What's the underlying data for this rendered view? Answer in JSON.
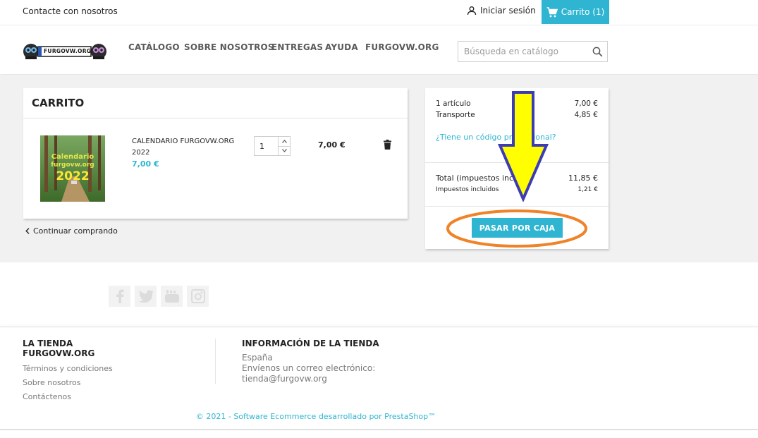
{
  "topbar": {
    "contact": "Contacte con nosotros",
    "signin": "Iniciar sesión",
    "cart": "Carrito (1)"
  },
  "header": {
    "logo_text": "FURGOVW.ORG",
    "menu": [
      "CATÁLOGO",
      "SOBRE NOSOTROS",
      "ENTREGAS",
      "AYUDA",
      "FURGOVW.ORG"
    ],
    "search_placeholder": "Búsqueda en catálogo"
  },
  "cart": {
    "title": "CARRITO",
    "product": {
      "name": "CALENDARIO FURGOVW.ORG 2022",
      "price": "7,00 €",
      "image_text_line1": "Calendario",
      "image_text_line2": "furgovw.org",
      "image_text_line3": "2022",
      "quantity": "1",
      "line_total": "7,00 €"
    },
    "continue": "Continuar comprando"
  },
  "summary": {
    "items_label": "1 artículo",
    "items_value": "7,00 €",
    "shipping_label": "Transporte",
    "shipping_value": "4,85 €",
    "promo": "¿Tiene un código promocional?",
    "total_label": "Total (impuestos inc.)",
    "total_value": "11,85 €",
    "tax_label": "Impuestos incluidos",
    "tax_value": "1,21 €",
    "checkout": "PASAR POR CAJA"
  },
  "footer": {
    "store_title": "LA TIENDA FURGOVW.ORG",
    "links": [
      "Términos y condiciones",
      "Sobre nosotros",
      "Contáctenos"
    ],
    "info_title": "INFORMACIÓN DE LA TIENDA",
    "info_lines": [
      "España",
      "Envíenos un correo electrónico:",
      "tienda@furgovw.org"
    ],
    "copyright": "© 2021 - Software Ecommerce desarrollado por PrestaShop™"
  },
  "colors": {
    "accent": "#2fb5d2",
    "annotation_arrow_fill": "#ffff00",
    "annotation_arrow_stroke": "#3c3cb4",
    "annotation_ellipse": "#f08228"
  },
  "icons": [
    "user-icon",
    "cart-icon",
    "search-icon",
    "trash-icon",
    "chevron-left-icon",
    "facebook-icon",
    "twitter-icon",
    "youtube-icon",
    "instagram-icon"
  ]
}
